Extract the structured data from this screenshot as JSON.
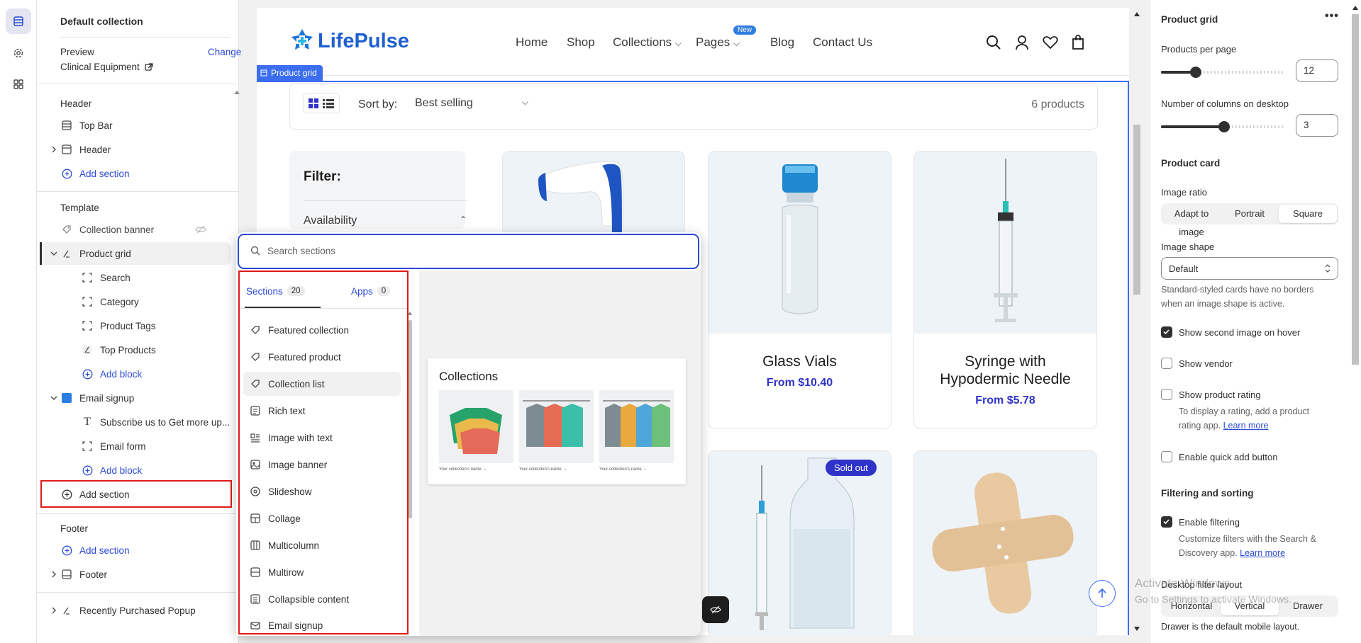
{
  "left_panel": {
    "collection_title": "Default collection",
    "preview_label": "Preview",
    "change_label": "Change",
    "preview_value": "Clinical Equipment",
    "header_group": "Header",
    "top_bar": "Top Bar",
    "header_item": "Header",
    "add_section": "Add section",
    "template_group": "Template",
    "collection_banner": "Collection banner",
    "product_grid": "Product grid",
    "blocks": [
      "Search",
      "Category",
      "Product Tags",
      "Top Products"
    ],
    "add_block": "Add block",
    "email_signup": "Email signup",
    "subscribe": "Subscribe us to Get more up...",
    "email_form": "Email form",
    "footer_group": "Footer",
    "footer_item": "Footer",
    "recently_purchased": "Recently Purchased Popup"
  },
  "store": {
    "logo": "LifePulse",
    "nav": [
      "Home",
      "Shop",
      "Collections",
      "Pages",
      "Blog",
      "Contact Us"
    ],
    "new_badge": "New",
    "section_tag": "Product grid",
    "sort_label": "Sort by:",
    "sort_value": "Best selling",
    "product_count": "6 products",
    "filter_title": "Filter:",
    "availability": "Availability",
    "products": [
      {
        "title": "Glass Vials",
        "price": "From $10.40"
      },
      {
        "title": "Syringe with",
        "title2": "Hypodermic Needle",
        "price": "From $5.78"
      }
    ],
    "sold_out": "Sold out"
  },
  "popover": {
    "search_placeholder": "Search sections",
    "tab_sections": "Sections",
    "tab_sections_count": "20",
    "tab_apps": "Apps",
    "tab_apps_count": "0",
    "items": [
      "Featured collection",
      "Featured product",
      "Collection list",
      "Rich text",
      "Image with text",
      "Image banner",
      "Slideshow",
      "Collage",
      "Multicolumn",
      "Multirow",
      "Collapsible content",
      "Email signup"
    ],
    "preview_title": "Collections",
    "preview_caption": "Your collection's name →"
  },
  "right_panel": {
    "title": "Product grid",
    "products_per_page": "Products per page",
    "products_per_page_value": "12",
    "columns_desktop": "Number of columns on desktop",
    "columns_value": "3",
    "product_card": "Product card",
    "image_ratio": "Image ratio",
    "ratio_options": [
      "Adapt to image",
      "Portrait",
      "Square"
    ],
    "image_shape": "Image shape",
    "shape_value": "Default",
    "shape_help_1": "Standard-styled cards have no borders",
    "shape_help_2": "when an image shape is active.",
    "show_second_image": "Show second image on hover",
    "show_vendor": "Show vendor",
    "show_rating": "Show product rating",
    "rating_help_1": "To display a rating, add a product",
    "rating_help_2": "rating app.",
    "learn_more": "Learn more",
    "quick_add": "Enable quick add button",
    "filtering_sorting": "Filtering and sorting",
    "enable_filtering": "Enable filtering",
    "filter_help_1": "Customize filters with the Search &",
    "filter_help_2": "Discovery app.",
    "desktop_filter_layout": "Desktop filter layout",
    "layout_options": [
      "Horizontal",
      "Vertical",
      "Drawer"
    ],
    "drawer_note": "Drawer is the default mobile layout."
  },
  "watermark": {
    "line1": "Activate Windows",
    "line2": "Go to Settings to activate Windows."
  },
  "colors": {
    "accent": "#2c4bd6",
    "highlight": "#e01b1b",
    "price": "#2f33c9",
    "badge": "#2f33c9"
  }
}
